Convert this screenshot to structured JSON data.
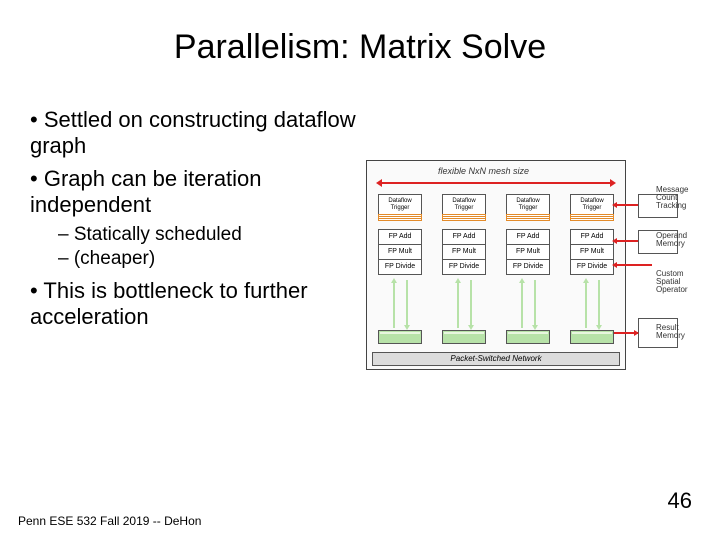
{
  "title": "Parallelism: Matrix Solve",
  "bullets": {
    "b1": "Settled on constructing dataflow graph",
    "b2": "Graph can be iteration independent",
    "b2s1": "Statically scheduled",
    "b2s2": "(cheaper)",
    "b3": "This is bottleneck to further acceleration"
  },
  "footer": "Penn ESE 532 Fall 2019 -- DeHon",
  "page": "46",
  "fig": {
    "mesh": "flexible NxN mesh size",
    "trigger": "Dataflow Trigger",
    "fpadd": "FP Add",
    "fpmult": "FP Mult",
    "fpdiv": "FP Divide",
    "net": "Packet-Switched Network",
    "msg": "Message Count Tracking",
    "operand": "Operand Memory",
    "custom": "Custom Spatial Operator",
    "result": "Result Memory"
  }
}
